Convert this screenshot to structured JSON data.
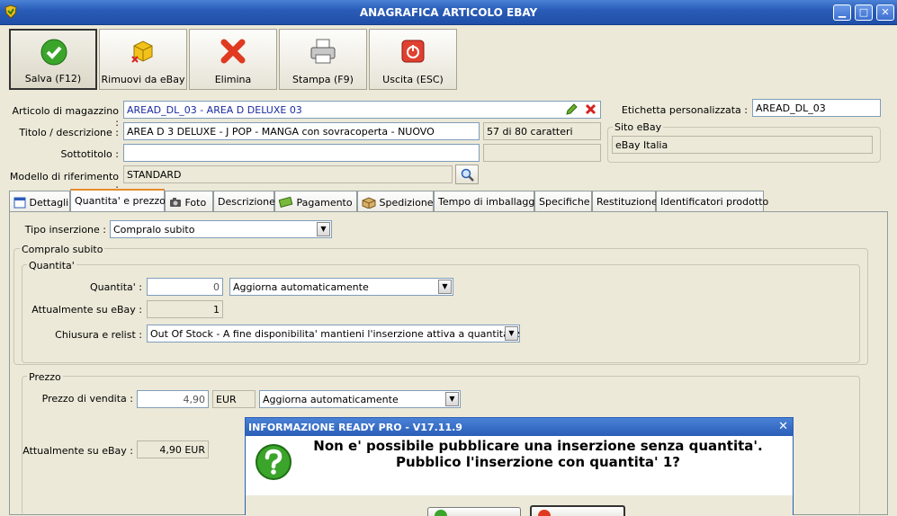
{
  "window": {
    "title": "ANAGRAFICA ARTICOLO EBAY",
    "btn_min": "▁",
    "btn_max": "□",
    "btn_close": "✕"
  },
  "toolbar": {
    "save": "Salva (F12)",
    "remove": "Rimuovi da eBay",
    "delete": "Elimina",
    "print": "Stampa (F9)",
    "exit": "Uscita (ESC)"
  },
  "form": {
    "articolo_label": "Articolo di magazzino :",
    "articolo_value": "AREAD_DL_03 - AREA D DELUXE 03",
    "titolo_label": "Titolo / descrizione :",
    "titolo_value": "AREA D 3 DELUXE - J POP -  MANGA con sovracoperta - NUOVO",
    "char_count": "57 di 80 caratteri",
    "sottotitolo_label": "Sottotitolo :",
    "sottotitolo_value": "",
    "modello_label": "Modello di riferimento :",
    "modello_value": "STANDARD",
    "etichetta_label": "Etichetta personalizzata :",
    "etichetta_value": "AREAD_DL_03",
    "sito_label": "Sito eBay",
    "sito_value": "eBay Italia"
  },
  "tabs": [
    "Dettagli",
    "Quantita' e prezzo",
    "Foto",
    "Descrizione",
    "Pagamento",
    "Spedizione",
    "Tempo di imballaggio",
    "Specifiche",
    "Restituzione",
    "Identificatori prodotto"
  ],
  "qty": {
    "tipo_label": "Tipo inserzione :",
    "tipo_value": "Compralo subito",
    "group_compralo": "Compralo subito",
    "group_quantita": "Quantita'",
    "quantita_label": "Quantita' :",
    "quantita_value": "0",
    "quantita_mode": "Aggiorna automaticamente",
    "attuale_label": "Attualmente su eBay :",
    "attuale_value": "1",
    "chiusura_label": "Chiusura e relist :",
    "chiusura_value": "Out Of Stock - A fine disponibilita' mantieni l'inserzione attiva a quantita' zero"
  },
  "price": {
    "group_prezzo": "Prezzo",
    "prezzo_label": "Prezzo di vendita :",
    "prezzo_value": "4,90",
    "currency": "EUR",
    "prezzo_mode": "Aggiorna automaticamente",
    "attuale_label": "Attualmente su eBay :",
    "attuale_value": "4,90 EUR"
  },
  "dialog": {
    "title": "INFORMAZIONE READY PRO - V17.11.9",
    "message": "Non e' possibile pubblicare una inserzione senza quantita'. Pubblico l'inserzione con quantita' 1?",
    "close": "✕"
  }
}
